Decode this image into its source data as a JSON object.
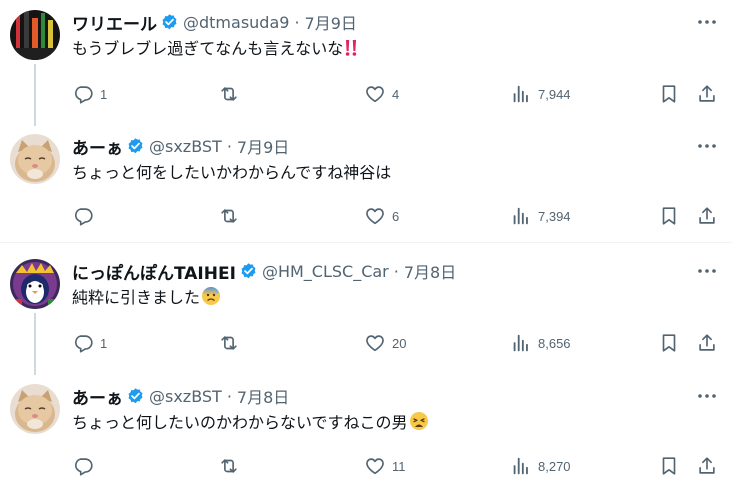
{
  "tweets": [
    {
      "name": "ワリエール",
      "handle": "@dtmasuda9",
      "dot": "·",
      "date": "7月9日",
      "text": "もうブレブレ過ぎてなんも言えないな",
      "emoji": "double-exclamation-icon",
      "replies": "1",
      "retweets": "",
      "likes": "4",
      "views": "7,944"
    },
    {
      "name": "あーぁ",
      "handle": "@sxzBST",
      "dot": "·",
      "date": "7月9日",
      "text": "ちょっと何をしたいかわからんですね神谷は",
      "emoji": "",
      "replies": "",
      "retweets": "",
      "likes": "6",
      "views": "7,394"
    },
    {
      "name": "にっぽんぽんTAIHEI",
      "handle": "@HM_CLSC_Car",
      "dot": "·",
      "date": "7月8日",
      "text": "純粋に引きました",
      "emoji": "anxious-face-with-sweat-icon",
      "replies": "1",
      "retweets": "",
      "likes": "20",
      "views": "8,656"
    },
    {
      "name": "あーぁ",
      "handle": "@sxzBST",
      "dot": "·",
      "date": "7月8日",
      "text": "ちょっと何したいのかわからないですねこの男",
      "emoji": "weary-face-icon",
      "replies": "",
      "retweets": "",
      "likes": "11",
      "views": "8,270"
    }
  ],
  "colors": {
    "verified": "#1d9bf0",
    "secondary_text": "#536471",
    "thread_line": "#cfd9de",
    "divider": "#eff3f4"
  }
}
